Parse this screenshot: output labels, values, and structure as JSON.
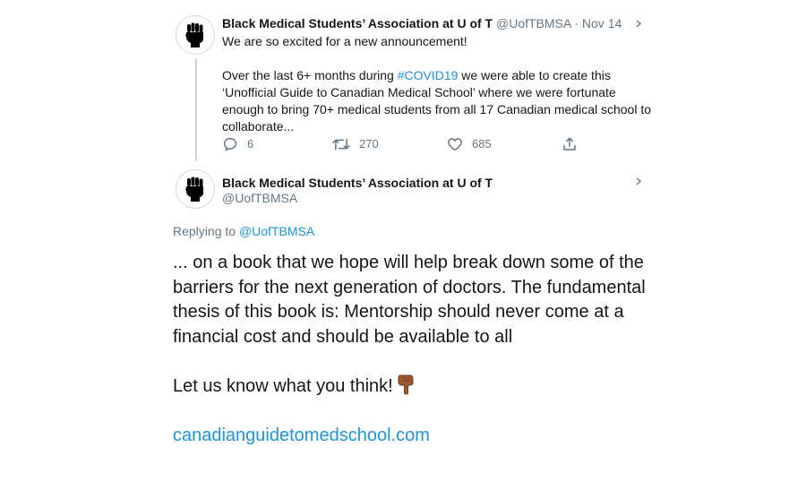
{
  "tweet1": {
    "author_name": "Black Medical Students’ Association at U of T",
    "handle": "@UofTBMSA",
    "separator": "·",
    "date": "Nov 14",
    "line1": "We are so excited for a new announcement!",
    "para2_before": "Over the last 6+ months during ",
    "hashtag": "#COVID19",
    "para2_after": " we were able to create this ‘Unofficial Guide to Canadian Medical School’ where we were fortunate enough to bring  70+ medical students from all 17 Canadian medical school to collaborate...",
    "replies": "6",
    "retweets": "270",
    "likes": "685"
  },
  "tweet2": {
    "author_name": "Black Medical Students’ Association at U of T",
    "handle": "@UofTBMSA",
    "replying_prefix": "Replying to ",
    "replying_handle": "@UofTBMSA",
    "body": "... on a book that we hope will help break down some of the barriers for the next generation of doctors. The fundamental thesis of this book is: Mentorship should never come at a financial cost and should be available to all",
    "cta": "Let us know what you think!",
    "url": "canadianguidetomedschool.com"
  },
  "icons": {
    "avatar": "raised-fist-icon",
    "more": "chevron-down-icon",
    "reply": "reply-icon",
    "retweet": "retweet-icon",
    "like": "heart-icon",
    "share": "share-icon",
    "emoji": "pointing-down-emoji"
  },
  "colors": {
    "link": "#1b95e0",
    "secondary_text": "#657786",
    "primary_text": "#14171a",
    "thread_line": "#ccd6dd"
  }
}
